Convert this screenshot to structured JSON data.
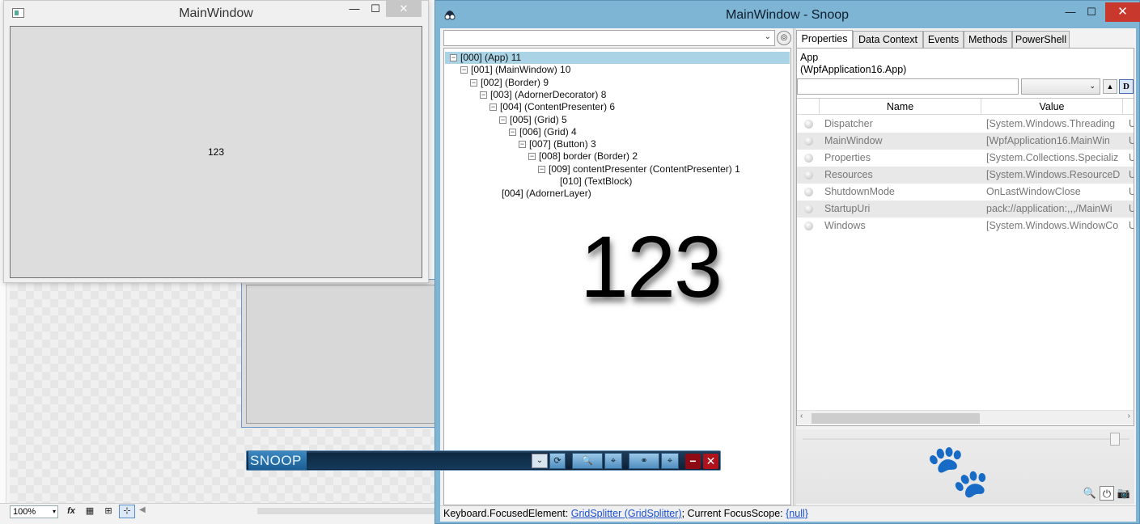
{
  "main_window": {
    "title": "MainWindow",
    "content_text": "123",
    "caption": {
      "minimize": "—",
      "maximize": "☐",
      "close": "✕"
    }
  },
  "ide": {
    "zoom": "100%",
    "zoom_arrow": "▾",
    "tools": [
      "fx",
      "▦",
      "⊞",
      "⊹"
    ],
    "scroll_arrow": "◀"
  },
  "snoop": {
    "title": "MainWindow - Snoop",
    "caption": {
      "minimize": "—",
      "maximize": "☐",
      "close": "✕"
    },
    "tree_combo_arrow": "⌄",
    "tree": [
      {
        "text": "[000]  (App) 11",
        "level": 0,
        "expander": "−",
        "selected": true
      },
      {
        "text": "[001]  (MainWindow) 10",
        "level": 1,
        "expander": "−",
        "selected": false
      },
      {
        "text": "[002]  (Border) 9",
        "level": 2,
        "expander": "−",
        "selected": false
      },
      {
        "text": "[003]  (AdornerDecorator) 8",
        "level": 3,
        "expander": "−",
        "selected": false
      },
      {
        "text": "[004]  (ContentPresenter) 6",
        "level": 4,
        "expander": "−",
        "selected": false
      },
      {
        "text": "[005]  (Grid) 5",
        "level": 5,
        "expander": "−",
        "selected": false
      },
      {
        "text": "[006]  (Grid) 4",
        "level": 6,
        "expander": "−",
        "selected": false
      },
      {
        "text": "[007]  (Button) 3",
        "level": 7,
        "expander": "−",
        "selected": false
      },
      {
        "text": "[008] border (Border) 2",
        "level": 8,
        "expander": "−",
        "selected": false
      },
      {
        "text": "[009] contentPresenter (ContentPresenter) 1",
        "level": 9,
        "expander": "−",
        "selected": false
      },
      {
        "text": "[010]  (TextBlock)",
        "level": 10,
        "expander": "",
        "selected": false
      },
      {
        "text": "[004]  (AdornerLayer)",
        "level": 4,
        "expander": "",
        "selected": false
      }
    ],
    "preview_text": "123",
    "tabs": [
      "Properties",
      "Data Context",
      "Events",
      "Methods",
      "PowerShell"
    ],
    "object_name": "App",
    "object_type": "(WpfApplication16.App)",
    "filter_placeholder": "",
    "filter_combo_arrow": "⌄",
    "sort_up": "▲",
    "d_button": "D",
    "columns": {
      "name": "Name",
      "value": "Value"
    },
    "properties": [
      {
        "name": "Dispatcher",
        "value": "[System.Windows.Threading",
        "extra": "U"
      },
      {
        "name": "MainWindow",
        "value": "[WpfApplication16.MainWin",
        "extra": "U"
      },
      {
        "name": "Properties",
        "value": "[System.Collections.Specializ",
        "extra": "U"
      },
      {
        "name": "Resources",
        "value": "[System.Windows.ResourceD",
        "extra": "U"
      },
      {
        "name": "ShutdownMode",
        "value": "OnLastWindowClose",
        "extra": "U"
      },
      {
        "name": "StartupUri",
        "value": "pack://application:,,,/MainWi",
        "extra": "U"
      },
      {
        "name": "Windows",
        "value": "[System.Windows.WindowCo",
        "extra": "U"
      }
    ],
    "scroll_left": "‹",
    "scroll_right": "›",
    "status": {
      "prefix": "Keyboard.FocusedElement: ",
      "focused": "GridSplitter (GridSplitter)",
      "middle": "; Current FocusScope: ",
      "scope": "{null}"
    }
  },
  "snoop_bar": {
    "logo": "SNOOP",
    "dropdown": "⌄",
    "minimize": "−",
    "close": "✕"
  }
}
